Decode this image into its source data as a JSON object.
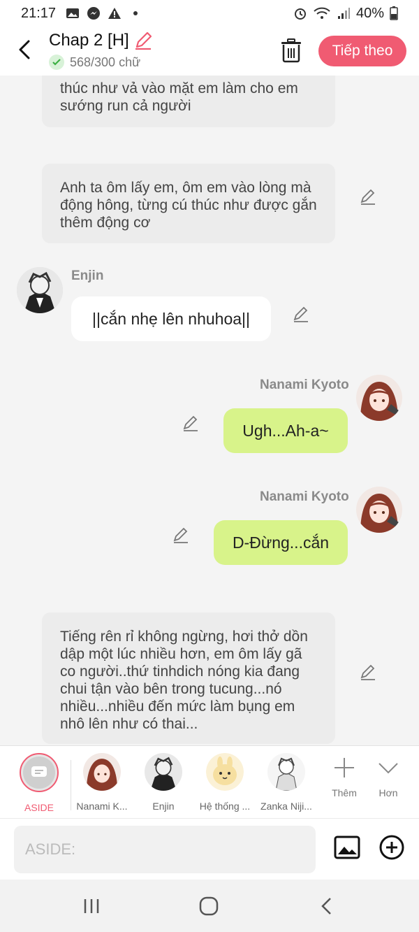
{
  "status_bar": {
    "time": "21:17",
    "battery": "40%"
  },
  "header": {
    "title": "Chap 2 [H]",
    "word_count": "568/300 chữ",
    "next_label": "Tiếp theo"
  },
  "messages": {
    "narration_1": "thúc như vả vào mặt em làm cho em sướng run cả người",
    "narration_2": "Anh ta ôm lấy em, ôm em vào lòng mà động hông, từng cú thúc như được gắn thêm động cơ",
    "enjin_name": "Enjin",
    "enjin_text": "||cắn nhẹ lên nhuhoa||",
    "nanami_name_1": "Nanami Kyoto",
    "nanami_text_1": "Ugh...Ah-a~",
    "nanami_name_2": "Nanami Kyoto",
    "nanami_text_2": "D-Đừng...cắn",
    "narration_3": "Tiếng rên rỉ không ngừng, hơi thở dồn dập một lúc nhiều hơn, em ôm lấy gã co người..thứ tinhdich nóng kia đang chui tận vào bên trong tucung...nó nhiều...nhiều đến mức làm bụng em nhô lên như có thai..."
  },
  "characters": {
    "aside": "ASIDE",
    "nanami": "Nanami K...",
    "enjin": "Enjin",
    "system": "Hệ thống ...",
    "zanka": "Zanka Niji...",
    "more": "Thêm",
    "hon": "Hơn"
  },
  "input": {
    "placeholder": "ASIDE:"
  },
  "colors": {
    "accent": "#f05b72",
    "green_bubble": "#d8f38a",
    "narration_bg": "#ececec"
  }
}
